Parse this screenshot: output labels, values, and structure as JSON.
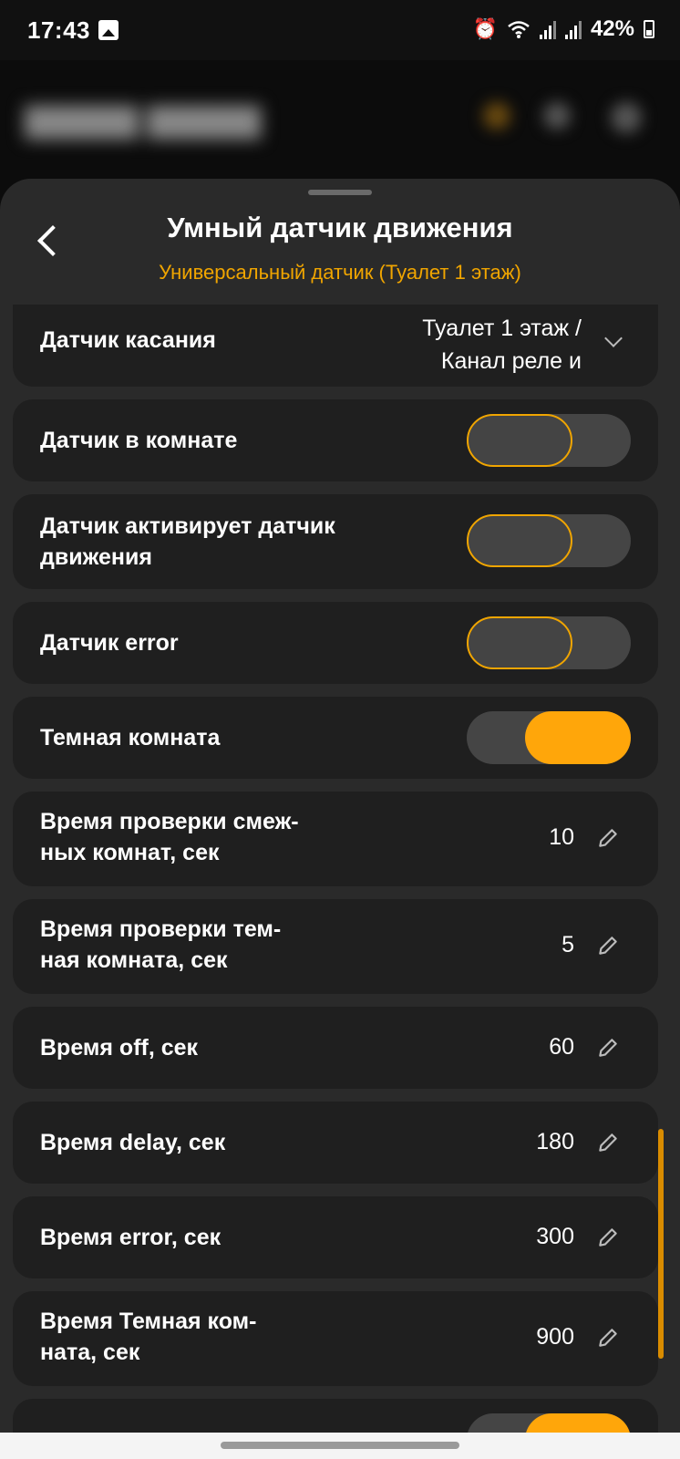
{
  "status_bar": {
    "time": "17:43",
    "battery": "42%",
    "icons": [
      "image-icon",
      "alarm-icon",
      "wifi-icon",
      "signal-icon",
      "signal-icon",
      "battery-icon"
    ]
  },
  "sheet": {
    "title": "Умный датчик движения",
    "subtitle": "Универсальный датчик (Туалет 1 этаж)",
    "accent_color": "#ffa60a"
  },
  "dropdown": {
    "label": "Датчик касания",
    "value_line1": "Туалет 1 этаж /",
    "value_line2": "Канал реле и"
  },
  "toggles": [
    {
      "label": "Датчик в комнате",
      "on": false
    },
    {
      "label": "Датчик активирует датчик",
      "label2": "движения",
      "on": false
    },
    {
      "label": "Датчик error",
      "on": false
    },
    {
      "label": "Темная комната",
      "on": true
    }
  ],
  "fields": [
    {
      "label": "Время проверки смеж-",
      "label2": "ных комнат, сек",
      "value": "10"
    },
    {
      "label": "Время проверки тем-",
      "label2": "ная комната, сек",
      "value": "5"
    },
    {
      "label": "Время off, сек",
      "value": "60"
    },
    {
      "label": "Время delay, сек",
      "value": "180"
    },
    {
      "label": "Время error, сек",
      "value": "300"
    },
    {
      "label": "Время Темная ком-",
      "label2": "ната, сек",
      "value": "900"
    }
  ]
}
